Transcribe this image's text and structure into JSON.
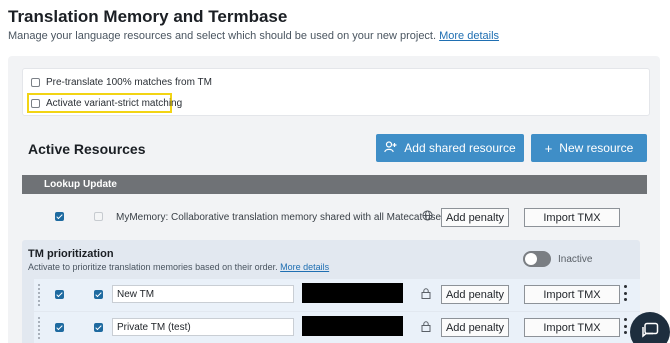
{
  "header": {
    "title": "Translation Memory and Termbase",
    "subtitle": "Manage your language resources and select which should be used on your new project.",
    "more_details_link": "More details"
  },
  "options": {
    "pretranslate_label": "Pre-translate 100% matches from TM",
    "pretranslate_checked": false,
    "variant_strict_label": "Activate variant-strict matching",
    "variant_strict_checked": false
  },
  "active_resources": {
    "title": "Active Resources",
    "add_shared_label": "Add shared resource",
    "new_resource_label": "New resource"
  },
  "table": {
    "col_lookup": "Lookup",
    "col_update": "Update"
  },
  "mymemory": {
    "lookup_checked": true,
    "update_checked": false,
    "description": "MyMemory: Collaborative translation memory shared with all Matecat users.",
    "add_penalty_label": "Add penalty",
    "import_tmx_label": "Import TMX"
  },
  "prioritization": {
    "title": "TM prioritization",
    "description": "Activate to prioritize translation memories based on their order.",
    "more_details_link": "More details",
    "toggle_state": "Inactive"
  },
  "tm_rows": [
    {
      "name": "New TM",
      "lookup": true,
      "update": true,
      "add_penalty_label": "Add penalty",
      "import_tmx_label": "Import TMX"
    },
    {
      "name": "Private TM (test)",
      "lookup": true,
      "update": true,
      "add_penalty_label": "Add penalty",
      "import_tmx_label": "Import TMX"
    }
  ],
  "colors": {
    "accent_blue": "#3f8ec7",
    "highlight_yellow": "#f2d414",
    "header_gray": "#6f7276"
  }
}
